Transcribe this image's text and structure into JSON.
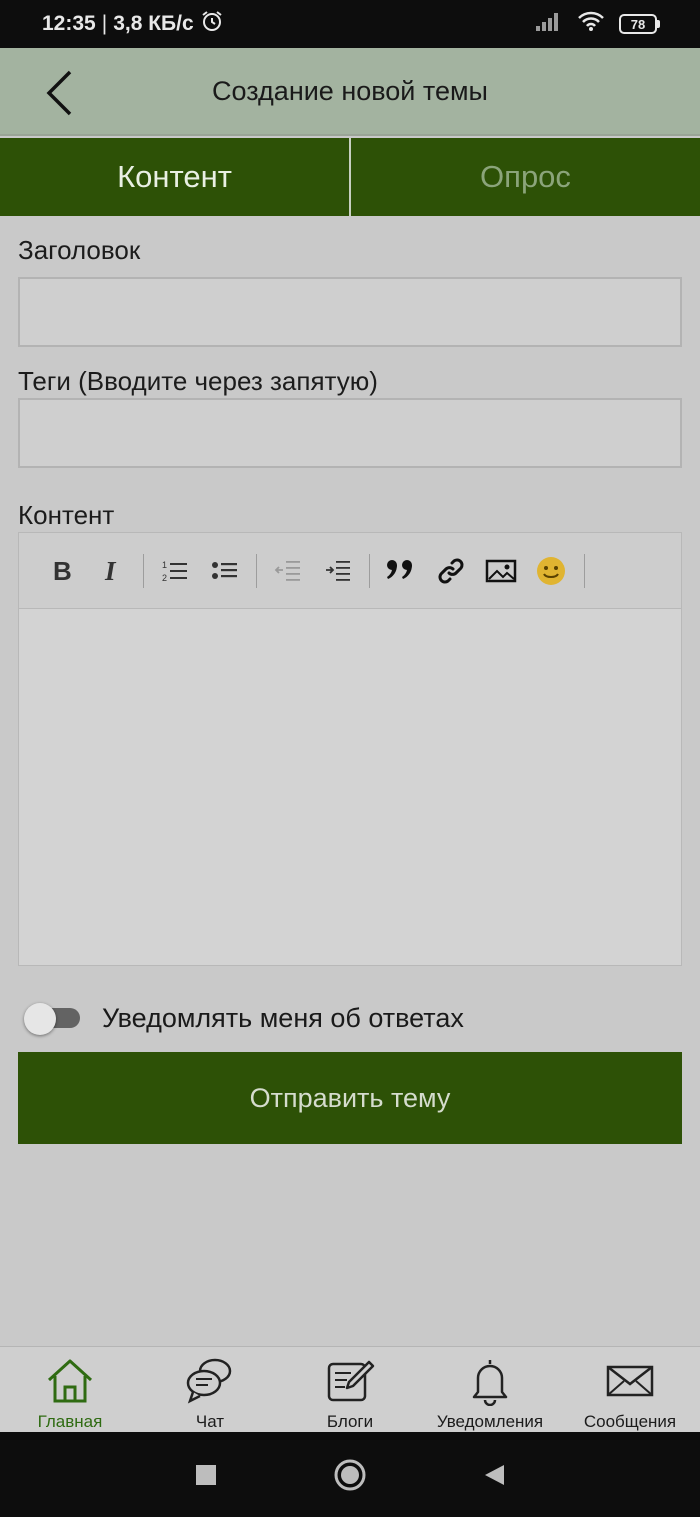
{
  "status_bar": {
    "time": "12:35",
    "separator": "|",
    "speed": "3,8 КБ/с",
    "battery": "78"
  },
  "app_bar": {
    "title": "Создание новой темы"
  },
  "tabs": [
    {
      "label": "Контент"
    },
    {
      "label": "Опрос"
    }
  ],
  "form": {
    "title_label": "Заголовок",
    "title_value": "",
    "tags_label": "Теги (Вводите через запятую)",
    "tags_value": "",
    "content_label": "Контент"
  },
  "editor": {
    "toolbar_icons": [
      "bold-icon",
      "italic-icon",
      "ordered-list-icon",
      "bullet-list-icon",
      "outdent-icon",
      "indent-icon",
      "quote-icon",
      "link-icon",
      "image-icon",
      "emoji-icon"
    ]
  },
  "notify": {
    "label": "Уведомлять меня об ответах",
    "enabled": false
  },
  "submit": {
    "label": "Отправить тему"
  },
  "bottom_nav": [
    {
      "label": "Главная",
      "icon": "home-icon",
      "active": true
    },
    {
      "label": "Чат",
      "icon": "chat-icon",
      "active": false
    },
    {
      "label": "Блоги",
      "icon": "blog-icon",
      "active": false
    },
    {
      "label": "Уведомления",
      "icon": "bell-icon",
      "active": false
    },
    {
      "label": "Сообщения",
      "icon": "envelope-icon",
      "active": false
    }
  ],
  "colors": {
    "primary": "#2d5106",
    "app_bar": "#a3b3a0",
    "background": "#c9c9c9",
    "active_nav": "#2f6b12",
    "inactive_tab_text": "#8ba47a"
  }
}
